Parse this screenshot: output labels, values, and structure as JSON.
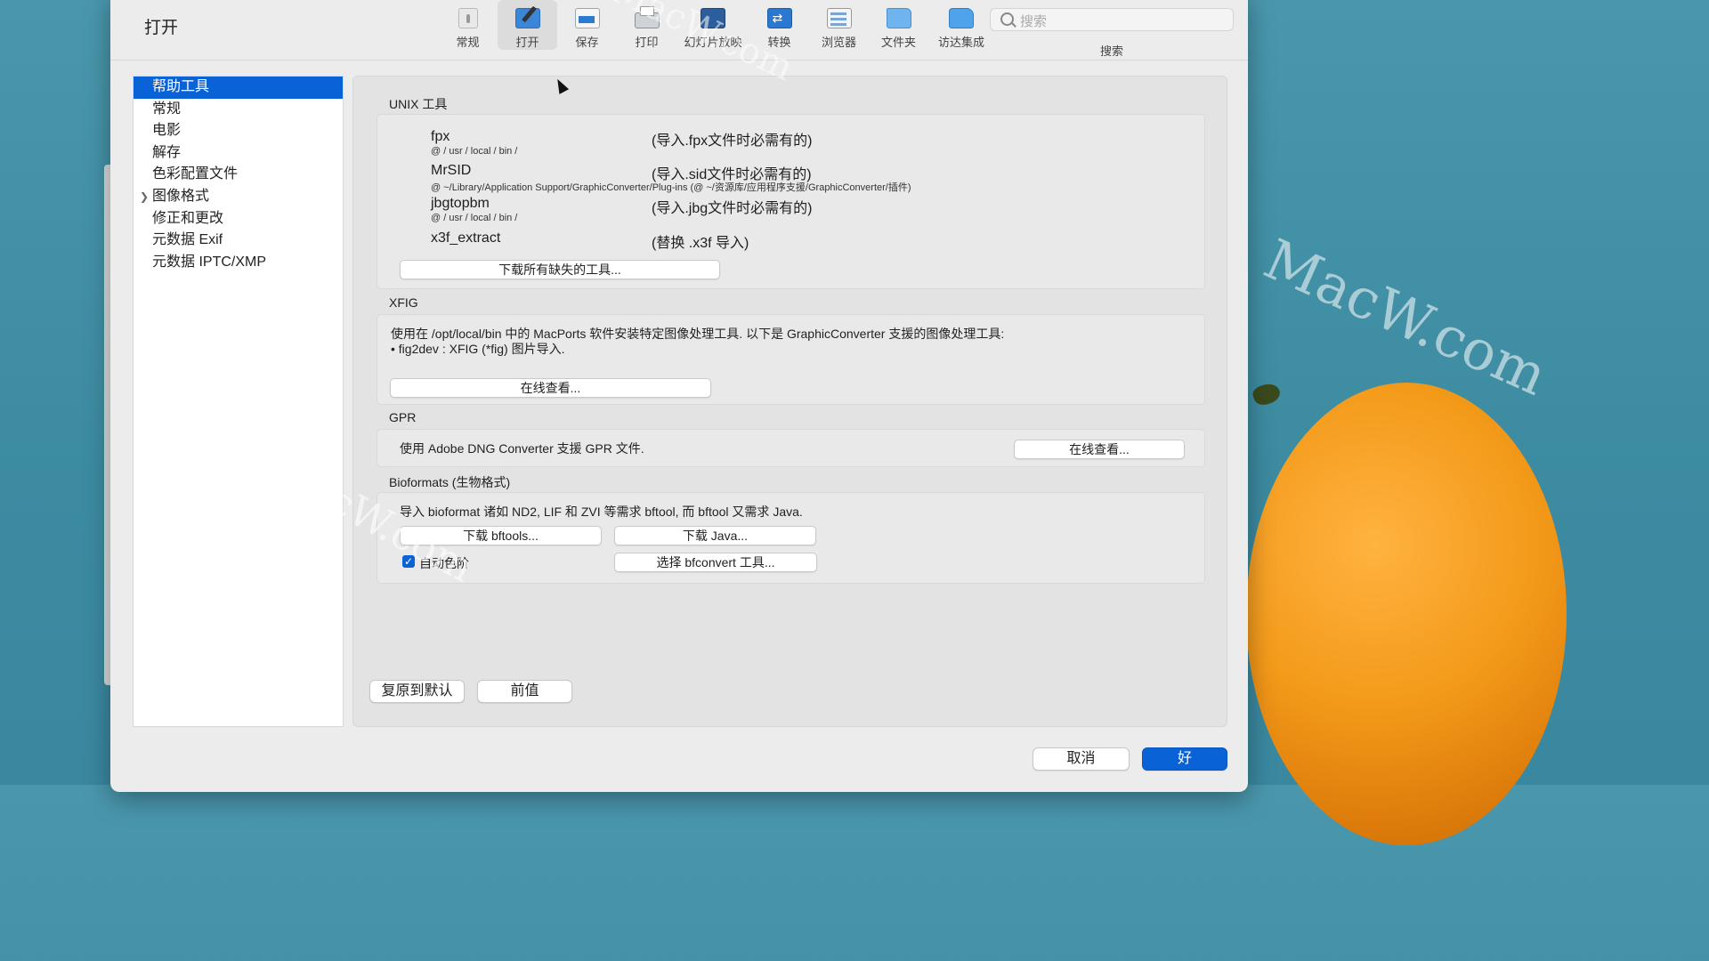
{
  "window": {
    "title": "打开"
  },
  "toolbar": {
    "items": [
      {
        "label": "常规",
        "icon": "general-icon"
      },
      {
        "label": "打开",
        "icon": "open-icon"
      },
      {
        "label": "保存",
        "icon": "save-icon"
      },
      {
        "label": "打印",
        "icon": "print-icon"
      },
      {
        "label": "幻灯片放映",
        "icon": "slideshow-icon"
      },
      {
        "label": "转换",
        "icon": "convert-icon"
      },
      {
        "label": "浏览器",
        "icon": "browser-icon"
      },
      {
        "label": "文件夹",
        "icon": "folder-icon"
      },
      {
        "label": "访达集成",
        "icon": "finder-icon"
      }
    ],
    "active": "打开",
    "search": {
      "placeholder": "搜索",
      "label": "搜索"
    }
  },
  "sidebar": {
    "items": [
      {
        "label": "帮助工具",
        "selected": true
      },
      {
        "label": "常规"
      },
      {
        "label": "电影"
      },
      {
        "label": "解存"
      },
      {
        "label": "色彩配置文件"
      },
      {
        "label": "图像格式",
        "expandable": true
      },
      {
        "label": "修正和更改"
      },
      {
        "label": "元数据 Exif"
      },
      {
        "label": "元数据 IPTC/XMP"
      }
    ]
  },
  "unix": {
    "title": "UNIX 工具",
    "tools": [
      {
        "name": "fpx",
        "path": "@ / usr / local / bin /",
        "desc": "(导入.fpx文件时必需有的)"
      },
      {
        "name": "MrSID",
        "path": "@ ~/Library/Application Support/GraphicConverter/Plug-ins (@ ~/资源库/应用程序支援/GraphicConverter/插件)",
        "desc": "(导入.sid文件时必需有的)"
      },
      {
        "name": "jbgtopbm",
        "path": "@ / usr / local / bin /",
        "desc": "(导入.jbg文件时必需有的)"
      },
      {
        "name": "x3f_extract",
        "path": "",
        "desc": "(替换 .x3f 导入)"
      }
    ],
    "download_button": "下载所有缺失的工具..."
  },
  "xfig": {
    "title": "XFIG",
    "line1": "使用在 /opt/local/bin 中的 MacPorts 软件安装特定图像处理工具. 以下是 GraphicConverter 支援的图像处理工具:",
    "line2": "• fig2dev : XFIG (*fig) 图片导入.",
    "button": "在线查看..."
  },
  "gpr": {
    "title": "GPR",
    "text": "使用 Adobe DNG Converter 支援 GPR 文件.",
    "button": "在线查看..."
  },
  "bioformats": {
    "title": "Bioformats (生物格式)",
    "text": "导入 bioformat 诸如 ND2, LIF 和 ZVI 等需求 bftool, 而 bftool 又需求 Java.",
    "download_bftools": "下载 bftools...",
    "download_java": "下载 Java...",
    "checkbox_label": "自动色阶",
    "checkbox_checked": true,
    "select_bfconvert": "选择 bfconvert 工具..."
  },
  "footer": {
    "restore_defaults": "复原到默认",
    "previous": "前值",
    "cancel": "取消",
    "ok": "好"
  },
  "watermark": "MacW.com",
  "colors": {
    "accent": "#0a62d7",
    "background": "#ececec"
  }
}
